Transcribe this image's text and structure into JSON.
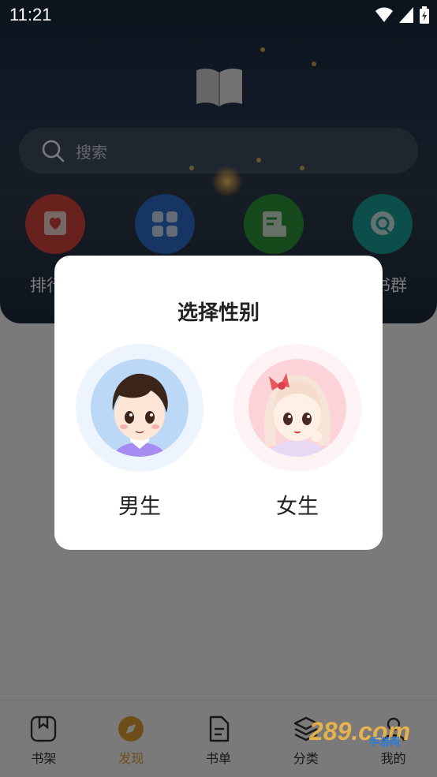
{
  "status_bar": {
    "time": "11:21"
  },
  "search": {
    "placeholder": "搜索"
  },
  "quick_entries": [
    {
      "label": "排行",
      "icon": "ranking-icon",
      "color": "#d9463d"
    },
    {
      "label": "",
      "icon": "apps-grid-icon",
      "color": "#2f6fd0"
    },
    {
      "label": "",
      "icon": "booklist-icon",
      "color": "#2e9a3a"
    },
    {
      "label": "书群",
      "icon": "chat-bubble-icon",
      "color": "#1aa39a"
    }
  ],
  "dialog": {
    "title": "选择性别",
    "options": [
      {
        "label": "男生",
        "avatar": "boy-avatar"
      },
      {
        "label": "女生",
        "avatar": "girl-avatar"
      }
    ]
  },
  "tabs": [
    {
      "label": "书架",
      "icon": "bookshelf-icon",
      "active": false
    },
    {
      "label": "发现",
      "icon": "compass-icon",
      "active": true
    },
    {
      "label": "书单",
      "icon": "document-icon",
      "active": false
    },
    {
      "label": "分类",
      "icon": "layers-icon",
      "active": false
    },
    {
      "label": "我的",
      "icon": "profile-icon",
      "active": false
    }
  ],
  "watermark": {
    "text": "289.com",
    "sub": "手游网"
  },
  "colors": {
    "accent": "#e3a33a",
    "dialog_bg": "#ffffff"
  }
}
